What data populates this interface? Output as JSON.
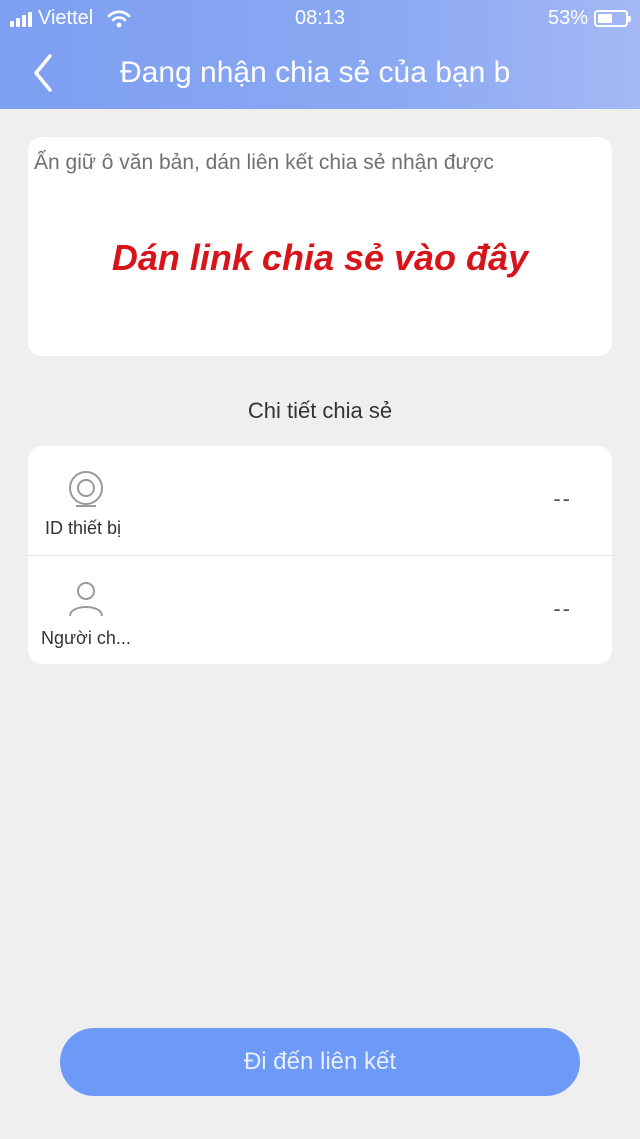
{
  "status_bar": {
    "carrier": "Viettel",
    "time": "08:13",
    "battery_percent": "53%",
    "battery_level": 0.53,
    "signal_bars": 4
  },
  "nav": {
    "title": "Đang nhận chia sẻ của bạn b",
    "back_icon": "chevron-left-icon"
  },
  "paste_box": {
    "placeholder": "Ấn giữ ô văn bản, dán liên kết chia sẻ nhận được",
    "hint": "Dán link chia sẻ vào đây",
    "hint_color": "#d8141b"
  },
  "details": {
    "title": "Chi tiết chia sẻ",
    "rows": [
      {
        "icon": "camera-icon",
        "label": "ID thiết bị",
        "value": "--"
      },
      {
        "icon": "user-icon",
        "label": "Người ch...",
        "value": "--"
      }
    ]
  },
  "button": {
    "label": "Đi đến liên kết",
    "color": "#6d9af6"
  },
  "colors": {
    "header": "#7d9ff0",
    "background": "#efefef"
  }
}
